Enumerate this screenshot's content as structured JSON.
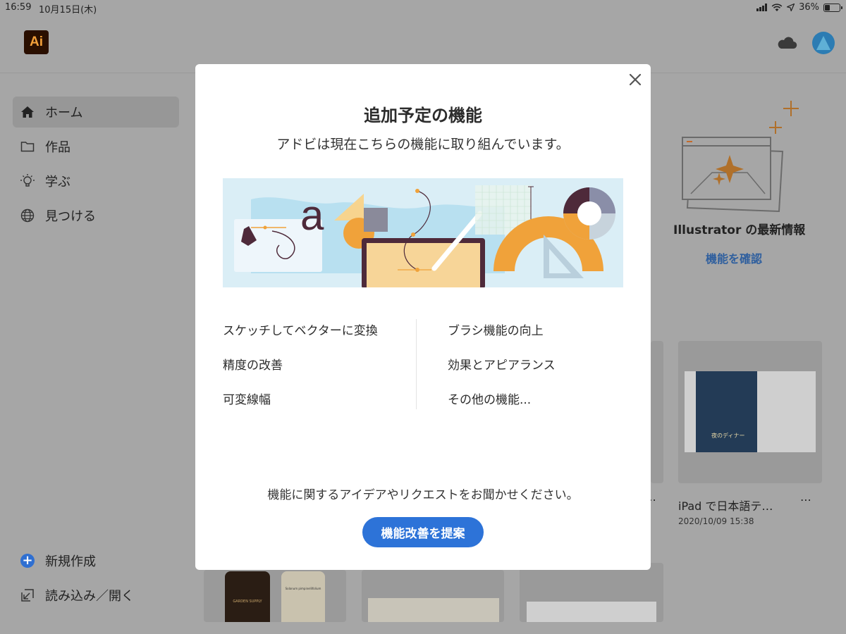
{
  "status_bar": {
    "time": "16:59",
    "date": "10月15日(木)",
    "battery": "36%"
  },
  "header": {
    "logo_text": "Ai"
  },
  "sidebar": {
    "items": [
      {
        "label": "ホーム",
        "icon": "home-icon",
        "active": true
      },
      {
        "label": "作品",
        "icon": "folder-icon"
      },
      {
        "label": "学ぶ",
        "icon": "lightbulb-icon"
      },
      {
        "label": "見つける",
        "icon": "globe-icon"
      }
    ],
    "bottom": [
      {
        "label": "新規作成",
        "icon": "plus-circle-icon"
      },
      {
        "label": "読み込み／開く",
        "icon": "import-icon"
      }
    ]
  },
  "background": {
    "whats_new_title": "Illustrator の最新情報",
    "whats_new_link": "機能を確認",
    "file_name": "iPad で日本語テ…",
    "file_date": "2020/10/09 15:38",
    "more": "⋯",
    "thumb_text": "夜のディナー",
    "garden": "GARDEN SUPPLY",
    "solanum": "Solanum pimpinellifolium"
  },
  "modal": {
    "title": "追加予定の機能",
    "subtitle": "アドビは現在こちらの機能に取り組んでいます。",
    "features_left": [
      "スケッチしてベクターに変換",
      "精度の改善",
      "可変線幅"
    ],
    "features_right": [
      "ブラシ機能の向上",
      "効果とアピアランス",
      "その他の機能..."
    ],
    "feedback_text": "機能に関するアイデアやリクエストをお聞かせください。",
    "suggest_button": "機能改善を提案"
  },
  "colors": {
    "accent": "#2d73d8",
    "overlay_bg": "#a6a6a6",
    "illustration_bg": "#d9edf5",
    "orange": "#f0a23a",
    "maroon": "#4e2a3a"
  }
}
